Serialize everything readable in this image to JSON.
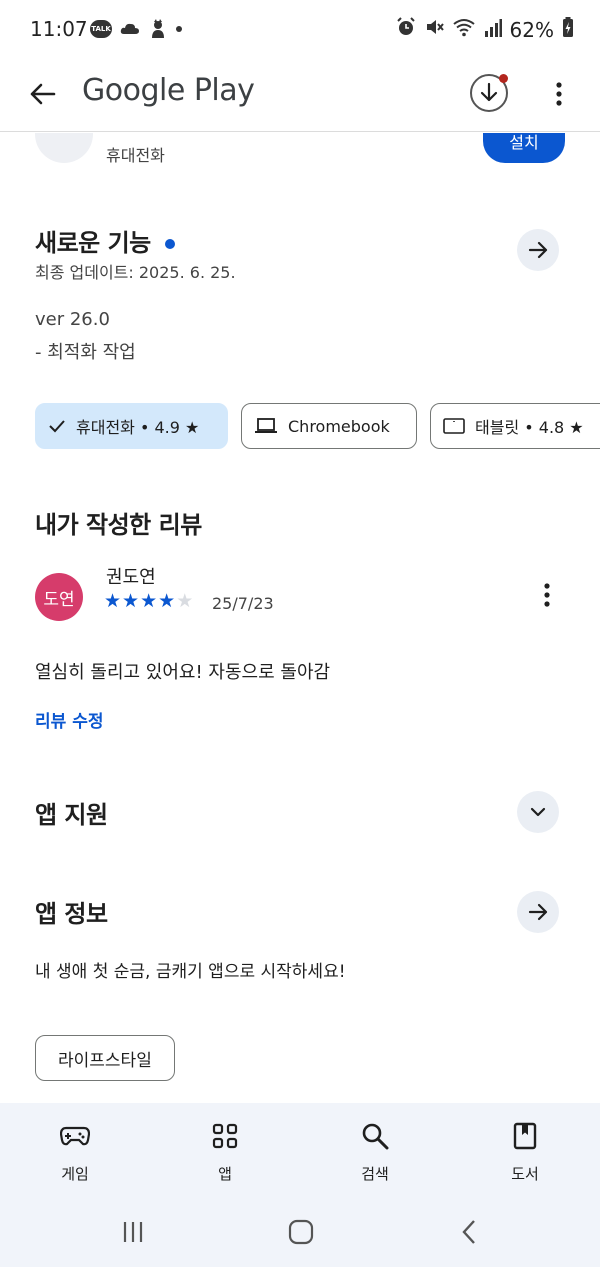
{
  "status_bar": {
    "time": "11:07",
    "talk_badge": "TALK",
    "battery": "62%"
  },
  "app_bar": {
    "title": "Google Play"
  },
  "install": {
    "device_label": "휴대전화",
    "button_label": "설치"
  },
  "whats_new": {
    "title": "새로운 기능",
    "updated": "최종 업데이트: 2025. 6. 25.",
    "version": "ver 26.0",
    "note": "- 최적화 작업"
  },
  "device_chips": [
    {
      "label": "휴대전화 • 4.9 ★",
      "selected": true
    },
    {
      "label": "Chromebook",
      "selected": false
    },
    {
      "label": "태블릿 • 4.8 ★",
      "selected": false
    }
  ],
  "my_review": {
    "title": "내가 작성한 리뷰",
    "avatar_text": "도연",
    "avatar_color": "#d63c6b",
    "reviewer": "권도연",
    "rating": 4,
    "rating_max": 5,
    "date": "25/7/23",
    "text": "열심히 돌리고 있어요! 자동으로 돌아감",
    "edit_label": "리뷰 수정"
  },
  "app_support": {
    "title": "앱 지원"
  },
  "app_info": {
    "title": "앱 정보",
    "description": "내 생애 첫 순금, 금캐기 앱으로 시작하세요!",
    "category": "라이프스타일"
  },
  "bottom_nav": [
    {
      "label": "게임",
      "icon": "gamepad-icon"
    },
    {
      "label": "앱",
      "icon": "apps-grid-icon"
    },
    {
      "label": "검색",
      "icon": "search-icon"
    },
    {
      "label": "도서",
      "icon": "book-icon"
    }
  ],
  "colors": {
    "accent": "#0b57d0",
    "chip_selected": "#d3e8fb",
    "nav_background": "#f1f4fa"
  }
}
